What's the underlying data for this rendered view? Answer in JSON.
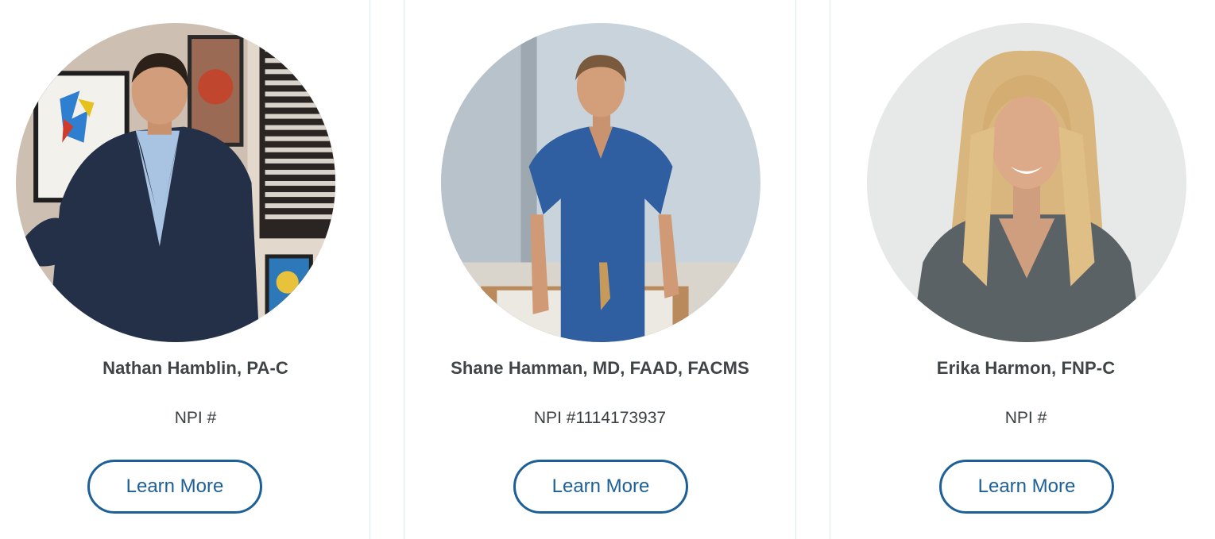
{
  "providers": [
    {
      "name": "Nathan Hamblin, PA-C",
      "npi": "NPI #",
      "button_label": "Learn More"
    },
    {
      "name": "Shane Hamman, MD, FAAD, FACMS",
      "npi": "NPI #1114173937",
      "button_label": "Learn More"
    },
    {
      "name": "Erika Harmon, FNP-C",
      "npi": "NPI #",
      "button_label": "Learn More"
    }
  ],
  "colors": {
    "accent": "#1d5f97",
    "text": "#3f4447",
    "card_border": "#dde9ee"
  }
}
